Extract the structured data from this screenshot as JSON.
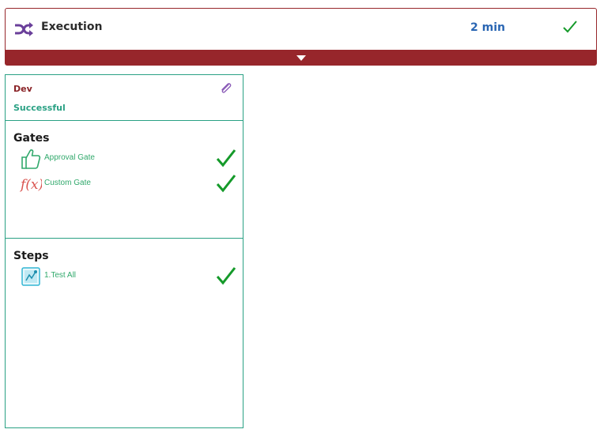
{
  "execution": {
    "title": "Execution",
    "duration": "2 min",
    "status_icon": "check-icon",
    "accent_color": "#97262b"
  },
  "stage": {
    "environment": "Dev",
    "status": "Successful",
    "gates": {
      "title": "Gates",
      "items": [
        {
          "label": "Approval Gate",
          "icon": "thumbs-up-icon",
          "status": "check-icon"
        },
        {
          "label": "Custom Gate",
          "icon": "function-icon",
          "status": "check-icon"
        }
      ]
    },
    "steps": {
      "title": "Steps",
      "items": [
        {
          "label": "1.Test All",
          "icon": "test-step-icon",
          "status": "check-icon"
        }
      ]
    }
  },
  "colors": {
    "success_green": "#2aa184",
    "check_green": "#159a2a",
    "duration_blue": "#2a66b3"
  }
}
